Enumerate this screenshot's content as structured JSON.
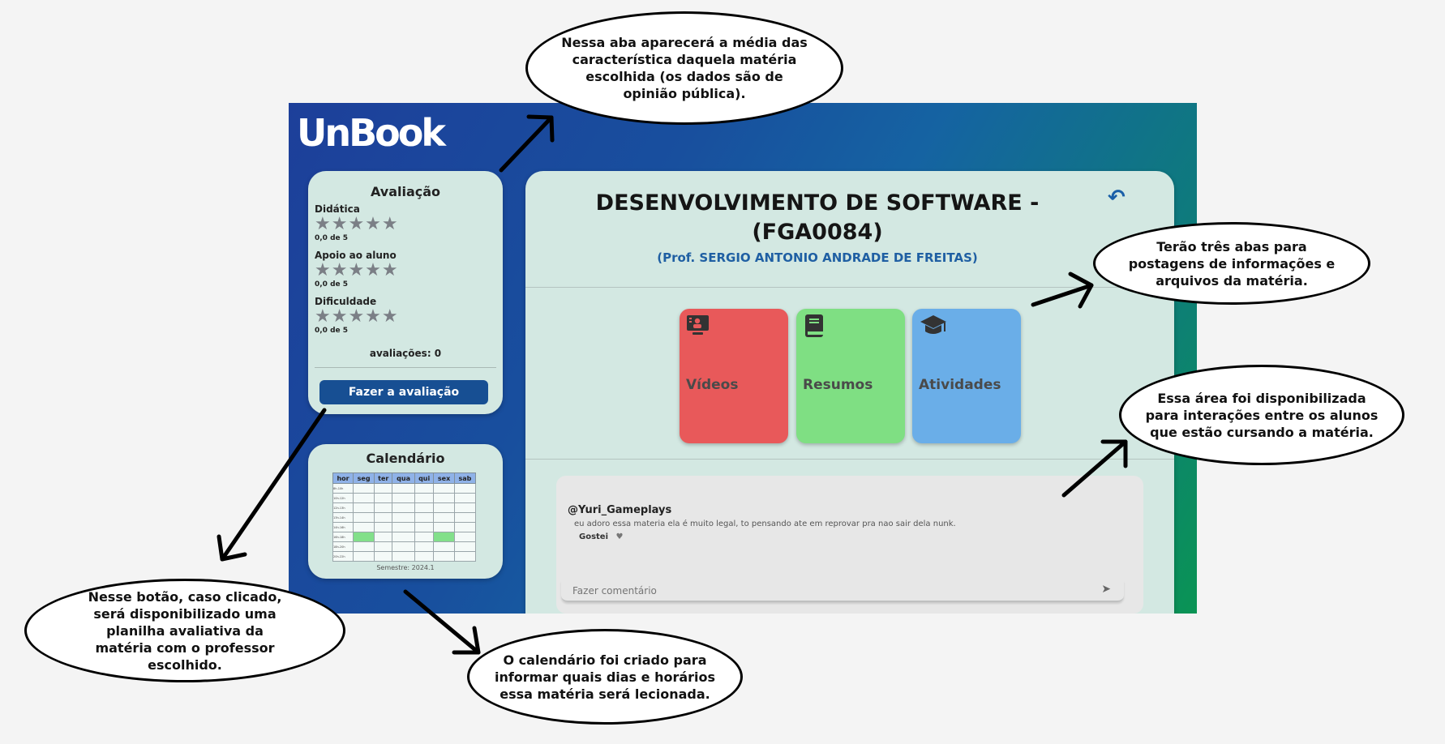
{
  "app": {
    "logo": "UnBook",
    "evaluation": {
      "title": "Avaliação",
      "criteria": [
        {
          "label": "Didática",
          "score": "0,0 de 5",
          "stars": "★★★★★"
        },
        {
          "label": "Apoio ao aluno",
          "score": "0,0 de 5",
          "stars": "★★★★★"
        },
        {
          "label": "Dificuldade",
          "score": "0,0 de 5",
          "stars": "★★★★★"
        }
      ],
      "count": "avaliações: 0",
      "button": "Fazer a avaliação"
    },
    "calendar": {
      "title": "Calendário",
      "headers": [
        "hor",
        "seg",
        "ter",
        "qua",
        "qui",
        "sex",
        "sab"
      ],
      "hours": [
        "8h-10h",
        "10h-12h",
        "12h-13h",
        "13h-14h",
        "14h-16h",
        "16h-18h",
        "18h-20h",
        "20h-22h"
      ],
      "semester": "Semestre: 2024.1"
    },
    "subject": {
      "title": "DESENVOLVIMENTO DE SOFTWARE - (FGA0084)",
      "professor": "(Prof. SERGIO ANTONIO ANDRADE DE FREITAS)",
      "back_icon": "undo-arrow-icon"
    },
    "tiles": [
      {
        "label": "Vídeos",
        "icon": "video-presentation-icon",
        "color": "#e8595a"
      },
      {
        "label": "Resumos",
        "icon": "book-icon",
        "color": "#7fdf83"
      },
      {
        "label": "Atividades",
        "icon": "graduation-cap-icon",
        "color": "#6aaee8"
      }
    ],
    "comments": {
      "user": "@Yuri_Gameplays",
      "text": "eu adoro essa materia ela é muito legal, to pensando ate em reprovar pra nao sair dela nunk.",
      "like_label": "Gostei",
      "placeholder": "Fazer comentário"
    }
  },
  "annotations": {
    "top": "Nessa aba aparecerá a média das característica daquela matéria escolhida (os dados são de opinião pública).",
    "tabs": "Terão três abas para postagens de informações e arquivos da matéria.",
    "comments": "Essa área foi disponibilizada para interações entre os alunos que estão cursando a matéria.",
    "button": "Nesse botão, caso clicado, será disponibilizado uma planilha avaliativa da matéria com o professor escolhido.",
    "calendar": "O calendário foi criado para informar quais dias e horários essa matéria será lecionada."
  }
}
